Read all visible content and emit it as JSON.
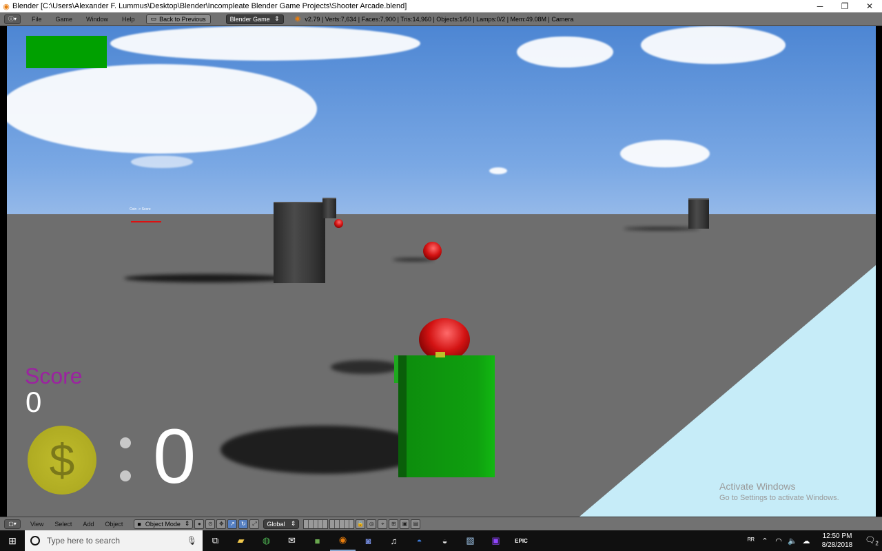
{
  "window": {
    "title": "Blender [C:\\Users\\Alexander F. Lummus\\Desktop\\Blender\\Incompleate Blender Game Projects\\Shooter Arcade.blend]",
    "minimize": "─",
    "restore": "❐",
    "close": "✕"
  },
  "info_header": {
    "menus": [
      "File",
      "Game",
      "Window",
      "Help"
    ],
    "back_button": "Back to Previous",
    "engine": "Blender Game",
    "stats": "v2.79 | Verts:7,634 | Faces:7,900 | Tris:14,960 | Objects:1/50 | Lamps:0/2 | Mem:49.08M | Camera"
  },
  "game_hud": {
    "tiny_label": "Coin -> Score",
    "score_label": "Score",
    "score_value": "0",
    "coin_symbol": "$",
    "coin_count": "0"
  },
  "watermark": {
    "line1": "Activate Windows",
    "line2": "Go to Settings to activate Windows."
  },
  "view_header": {
    "menus": [
      "View",
      "Select",
      "Add",
      "Object"
    ],
    "mode": "Object Mode",
    "orientation": "Global"
  },
  "taskbar": {
    "search_placeholder": "Type here to search",
    "apps": [
      "task-view-icon",
      "file-explorer-icon",
      "chrome-icon",
      "mail-icon",
      "minecraft-icon",
      "blender-icon",
      "discord-icon",
      "itunes-icon",
      "app-icon",
      "app-icon",
      "app-icon",
      "twitch-icon",
      "epic-games-icon"
    ],
    "epic_label": "EPIC",
    "time": "12:50 PM",
    "date": "8/28/2018",
    "notification_count": "2"
  },
  "colors": {
    "score_label": "#9b23a0",
    "coin": "#b1ad22",
    "hud_green": "#00a000",
    "blender_header": "#727272"
  }
}
